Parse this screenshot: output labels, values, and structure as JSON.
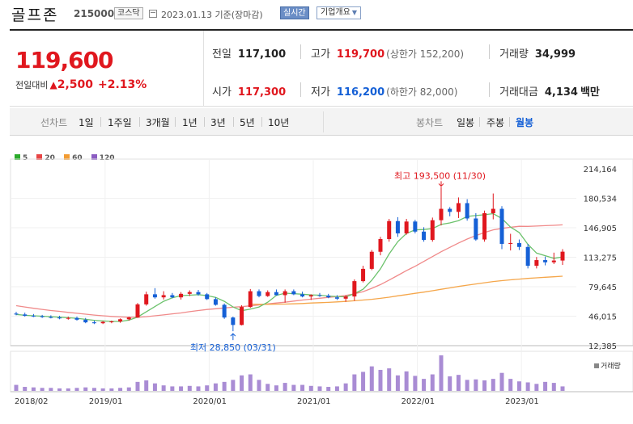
{
  "header": {
    "name": "골프존",
    "code": "215000",
    "market": "코스닥",
    "date": "2023.01.13  기준(장마감)",
    "live": "실시간",
    "company": "기업개요"
  },
  "quote": {
    "price": "119,600",
    "change_label": "전일대비",
    "change_arrow": "▲",
    "change": "2,500",
    "change_pct": "+2.13%",
    "prev_close_label": "전일",
    "prev_close": "117,100",
    "high_label": "고가",
    "high": "119,700",
    "upper_limit": "(상한가 152,200)",
    "volume_label": "거래량",
    "volume": "34,999",
    "open_label": "시가",
    "open": "117,300",
    "low_label": "저가",
    "low": "116,200",
    "lower_limit": "(하한가 82,000)",
    "value_label": "거래대금",
    "value": "4,134",
    "value_unit": "백만"
  },
  "tabs": {
    "line_chart": "선차트",
    "periods": [
      "1일",
      "1주일",
      "3개월",
      "1년",
      "3년",
      "5년",
      "10년"
    ],
    "candle_chart": "봉차트",
    "candle_types": [
      "일봉",
      "주봉",
      "월봉"
    ],
    "active_candle": "월봉"
  },
  "legend": [
    {
      "label": "5",
      "color": "#2bab2b"
    },
    {
      "label": "20",
      "color": "#e84545"
    },
    {
      "label": "60",
      "color": "#f39c32"
    },
    {
      "label": "120",
      "color": "#8b5cc2"
    }
  ],
  "chart_data": {
    "type": "candlestick",
    "period": "monthly",
    "x_labels": [
      "2018/02",
      "2019/01",
      "2020/01",
      "2021/01",
      "2022/01",
      "2023/01"
    ],
    "y_ticks": [
      "214,164",
      "180,534",
      "146,905",
      "113,275",
      "79,645",
      "46,015",
      "12,385"
    ],
    "ylim": [
      12385,
      214164
    ],
    "max_annotation": "최고 193,500 (11/30)",
    "min_annotation": "최저 28,850 (03/31)",
    "volume_label": "거래량",
    "up_color": "#e0171e",
    "down_color": "#1560d6",
    "candles": [
      {
        "o": 49000,
        "h": 51000,
        "l": 47000,
        "c": 48000
      },
      {
        "o": 48000,
        "h": 50000,
        "l": 45500,
        "c": 46500
      },
      {
        "o": 46500,
        "h": 48500,
        "l": 45000,
        "c": 46000
      },
      {
        "o": 46000,
        "h": 47500,
        "l": 44000,
        "c": 45000
      },
      {
        "o": 45000,
        "h": 47000,
        "l": 43500,
        "c": 44500
      },
      {
        "o": 44500,
        "h": 46500,
        "l": 42500,
        "c": 43500
      },
      {
        "o": 43500,
        "h": 45500,
        "l": 42000,
        "c": 44000
      },
      {
        "o": 44000,
        "h": 45500,
        "l": 41000,
        "c": 42000
      },
      {
        "o": 42000,
        "h": 44000,
        "l": 38000,
        "c": 39000
      },
      {
        "o": 39000,
        "h": 41000,
        "l": 37000,
        "c": 38000
      },
      {
        "o": 38000,
        "h": 40500,
        "l": 37000,
        "c": 39500
      },
      {
        "o": 39500,
        "h": 41000,
        "l": 38000,
        "c": 40000
      },
      {
        "o": 40000,
        "h": 43500,
        "l": 38500,
        "c": 42500
      },
      {
        "o": 42500,
        "h": 45500,
        "l": 41000,
        "c": 44500
      },
      {
        "o": 44500,
        "h": 61000,
        "l": 44000,
        "c": 59500
      },
      {
        "o": 59500,
        "h": 74000,
        "l": 58000,
        "c": 71000
      },
      {
        "o": 71000,
        "h": 78000,
        "l": 66000,
        "c": 67500
      },
      {
        "o": 67500,
        "h": 74500,
        "l": 65000,
        "c": 70000
      },
      {
        "o": 70000,
        "h": 72500,
        "l": 66500,
        "c": 67500
      },
      {
        "o": 67500,
        "h": 73500,
        "l": 65000,
        "c": 71500
      },
      {
        "o": 71500,
        "h": 75500,
        "l": 69000,
        "c": 73500
      },
      {
        "o": 73500,
        "h": 76000,
        "l": 69500,
        "c": 71000
      },
      {
        "o": 71000,
        "h": 72500,
        "l": 64500,
        "c": 65500
      },
      {
        "o": 65500,
        "h": 67500,
        "l": 58000,
        "c": 59000
      },
      {
        "o": 59000,
        "h": 60500,
        "l": 43000,
        "c": 44500
      },
      {
        "o": 44500,
        "h": 45500,
        "l": 28850,
        "c": 36000
      },
      {
        "o": 36000,
        "h": 58500,
        "l": 35500,
        "c": 56500
      },
      {
        "o": 56500,
        "h": 77000,
        "l": 55500,
        "c": 74500
      },
      {
        "o": 74500,
        "h": 76500,
        "l": 67500,
        "c": 69000
      },
      {
        "o": 69000,
        "h": 75500,
        "l": 68000,
        "c": 73500
      },
      {
        "o": 73500,
        "h": 76500,
        "l": 69500,
        "c": 70000
      },
      {
        "o": 70000,
        "h": 76500,
        "l": 61500,
        "c": 74500
      },
      {
        "o": 74500,
        "h": 76500,
        "l": 70000,
        "c": 71000
      },
      {
        "o": 71000,
        "h": 74000,
        "l": 67500,
        "c": 68500
      },
      {
        "o": 68500,
        "h": 71000,
        "l": 64500,
        "c": 70000
      },
      {
        "o": 70000,
        "h": 72500,
        "l": 68000,
        "c": 69500
      },
      {
        "o": 69500,
        "h": 71500,
        "l": 66500,
        "c": 67500
      },
      {
        "o": 67500,
        "h": 70000,
        "l": 64500,
        "c": 66000
      },
      {
        "o": 66000,
        "h": 70000,
        "l": 62500,
        "c": 68500
      },
      {
        "o": 68500,
        "h": 88000,
        "l": 63500,
        "c": 86000
      },
      {
        "o": 86000,
        "h": 103500,
        "l": 84500,
        "c": 100000
      },
      {
        "o": 100000,
        "h": 121500,
        "l": 98500,
        "c": 119500
      },
      {
        "o": 119500,
        "h": 136500,
        "l": 115500,
        "c": 134000
      },
      {
        "o": 134000,
        "h": 157000,
        "l": 131000,
        "c": 154500
      },
      {
        "o": 154500,
        "h": 159000,
        "l": 136500,
        "c": 140500
      },
      {
        "o": 140500,
        "h": 157000,
        "l": 139000,
        "c": 154000
      },
      {
        "o": 154000,
        "h": 156000,
        "l": 140500,
        "c": 142500
      },
      {
        "o": 142500,
        "h": 147500,
        "l": 131000,
        "c": 133000
      },
      {
        "o": 133000,
        "h": 158500,
        "l": 131000,
        "c": 155500
      },
      {
        "o": 155500,
        "h": 193500,
        "l": 149500,
        "c": 168500
      },
      {
        "o": 168500,
        "h": 170500,
        "l": 160000,
        "c": 165000
      },
      {
        "o": 165000,
        "h": 181500,
        "l": 158000,
        "c": 175000
      },
      {
        "o": 175000,
        "h": 179500,
        "l": 155000,
        "c": 157500
      },
      {
        "o": 157500,
        "h": 163500,
        "l": 132000,
        "c": 133500
      },
      {
        "o": 133500,
        "h": 166500,
        "l": 131000,
        "c": 163500
      },
      {
        "o": 163500,
        "h": 186000,
        "l": 156500,
        "c": 168500
      },
      {
        "o": 168500,
        "h": 171500,
        "l": 122500,
        "c": 128500
      },
      {
        "o": 128500,
        "h": 140000,
        "l": 121000,
        "c": 129500
      },
      {
        "o": 129500,
        "h": 133500,
        "l": 121500,
        "c": 125000
      },
      {
        "o": 125000,
        "h": 128500,
        "l": 100500,
        "c": 103500
      },
      {
        "o": 103500,
        "h": 113500,
        "l": 100500,
        "c": 110000
      },
      {
        "o": 110000,
        "h": 114000,
        "l": 104000,
        "c": 107500
      },
      {
        "o": 107500,
        "h": 118500,
        "l": 105500,
        "c": 109500
      },
      {
        "o": 109500,
        "h": 122500,
        "l": 104500,
        "c": 119600
      }
    ],
    "ma5": [
      48000,
      47000,
      46500,
      46000,
      45500,
      44800,
      44300,
      43600,
      42400,
      41300,
      40600,
      40000,
      40000,
      41500,
      45000,
      51000,
      57000,
      63000,
      67000,
      69500,
      70000,
      70500,
      69500,
      67500,
      63000,
      56500,
      52300,
      54000,
      56500,
      62000,
      69700,
      72300,
      71700,
      71100,
      70300,
      70000,
      69000,
      68500,
      68000,
      71700,
      76800,
      87000,
      100000,
      117000,
      131000,
      140500,
      144500,
      144900,
      146000,
      150700,
      152400,
      155000,
      159800,
      160800,
      161700,
      163000,
      157500,
      147600,
      141500,
      128000,
      118000,
      115000,
      112000,
      113600
    ],
    "ma20": [
      58000,
      56500,
      55000,
      53800,
      52500,
      51500,
      50300,
      49300,
      48300,
      47300,
      46500,
      45700,
      45200,
      44800,
      44800,
      45500,
      46500,
      47500,
      48700,
      49700,
      51200,
      52500,
      53700,
      54500,
      55400,
      56200,
      56900,
      57800,
      58800,
      60000,
      61000,
      62000,
      63200,
      64400,
      65500,
      66500,
      67500,
      68400,
      69600,
      71500,
      74000,
      77800,
      82000,
      87200,
      92500,
      98000,
      103000,
      108500,
      114000,
      119500,
      124500,
      129500,
      134000,
      138000,
      141500,
      144500,
      146200,
      147500,
      148600,
      148500,
      148800,
      149300,
      149700,
      150200
    ],
    "ma60": [
      null,
      null,
      null,
      null,
      null,
      null,
      null,
      null,
      null,
      null,
      null,
      null,
      null,
      null,
      null,
      null,
      null,
      null,
      null,
      null,
      null,
      null,
      null,
      null,
      null,
      null,
      null,
      59800,
      59600,
      59600,
      59700,
      59800,
      60100,
      60500,
      61000,
      61400,
      61800,
      62300,
      62900,
      63600,
      64400,
      65300,
      66400,
      67700,
      69200,
      70600,
      72100,
      73500,
      75000,
      76700,
      78300,
      79900,
      81400,
      82800,
      84200,
      85500,
      86600,
      87500,
      88300,
      89100,
      89800,
      90400,
      91000,
      91600
    ],
    "ma120": [],
    "volumes": [
      1.2,
      0.8,
      0.7,
      0.6,
      0.6,
      0.5,
      0.5,
      0.6,
      0.7,
      0.6,
      0.5,
      0.5,
      0.6,
      0.7,
      1.8,
      2.1,
      1.5,
      1.1,
      0.9,
      0.9,
      1.0,
      0.9,
      1.1,
      1.5,
      1.8,
      2.2,
      3.1,
      3.3,
      2.2,
      1.4,
      1.1,
      1.6,
      1.2,
      1.2,
      1.0,
      0.9,
      0.8,
      0.9,
      1.5,
      3.3,
      3.8,
      4.9,
      4.2,
      4.5,
      3.1,
      3.9,
      3.0,
      2.4,
      3.3,
      7.1,
      2.9,
      3.2,
      2.2,
      2.3,
      2.1,
      2.4,
      3.6,
      2.4,
      1.9,
      1.7,
      1.4,
      1.8,
      1.6,
      0.9
    ]
  }
}
